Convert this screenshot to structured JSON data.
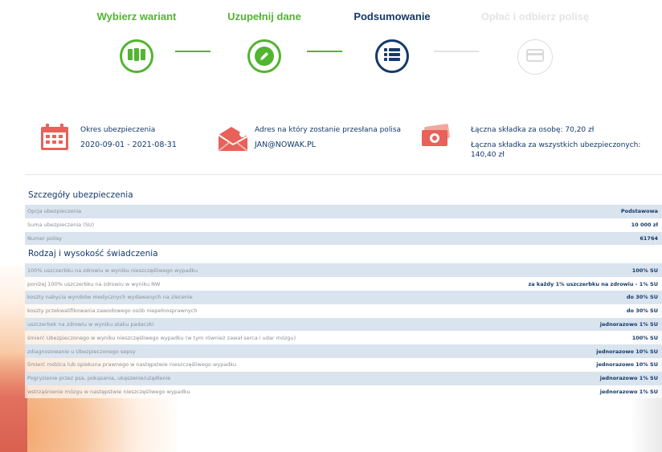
{
  "stepper": {
    "steps": [
      {
        "label": "Wybierz wariant",
        "state": "done",
        "icon": "columns-icon"
      },
      {
        "label": "Uzupełnij dane",
        "state": "done",
        "icon": "pencil-icon"
      },
      {
        "label": "Podsumowanie",
        "state": "active",
        "icon": "list-icon"
      },
      {
        "label": "Opłać i odbierz polisę",
        "state": "future",
        "icon": "card-icon"
      }
    ]
  },
  "summary": {
    "period_label": "Okres ubezpieczenia",
    "period_value": "2020-09-01 - 2021-08-31",
    "address_label": "Adres na który zostanie przesłana polisa",
    "address_value": "JAN@NOWAK.PL",
    "premium_person": "Łączna składka za osobę: 70,20 zł",
    "premium_total": "Łączna składka za wszystkich ubezpieczonych: 140,40 zł"
  },
  "details": {
    "title": "Szczegóły ubezpieczenia",
    "rows": [
      {
        "label": "Opcja ubezpieczenia",
        "value": "Podstawowa"
      },
      {
        "label": "Suma ubezpieczenia (SU)",
        "value": "10 000 zł"
      },
      {
        "label": "Numer polisy",
        "value": "61764"
      }
    ]
  },
  "benefits": {
    "title": "Rodzaj i wysokość świadczenia",
    "rows": [
      {
        "label": "100% uszczerbku na zdrowiu w wyniku nieszczęśliwego wypadku",
        "value": "100% SU"
      },
      {
        "label": "poniżej 100% uszczerbku na zdrowiu w wyniku NW",
        "value": "za każdy 1% uszczerbku na zdrowiu - 1% SU"
      },
      {
        "label": "koszty nabycia wyrobów medycznych wydawanych na zlecenie",
        "value": "do 30% SU"
      },
      {
        "label": "koszty przekwalifikowania zawodowego osób niepełnosprawnych",
        "value": "do 30% SU"
      },
      {
        "label": "uszczerbek na zdrowiu w wyniku ataku padaczki",
        "value": "jednorazowo 1% SU"
      },
      {
        "label": "śmierć Ubezpieczonego w wyniku nieszczęśliwego wypadku (w tym również zawał serca i udar mózgu)",
        "value": "100% SU"
      },
      {
        "label": "zdiagnozowanie u Ubezpieczonego sepsy",
        "value": "jednorazowo 10% SU"
      },
      {
        "label": "Śmierć rodzica lub opiekuna prawnego w następstwie nieszczęśliwego wypadku",
        "value": "jednorazowo 10% SU"
      },
      {
        "label": "Pogryzienie przez psa, pokąsania, ukąszenie/użądlenie",
        "value": "jednorazowo 1% SU"
      },
      {
        "label": "wstrząśnienie mózgu w następstwie nieszczęśliwego wypadku",
        "value": "jednorazowo 1% SU"
      }
    ]
  },
  "colors": {
    "green": "#52b530",
    "navy": "#15396a",
    "row_blue": "#d9e4ef",
    "icon_red": "#e8615a"
  }
}
